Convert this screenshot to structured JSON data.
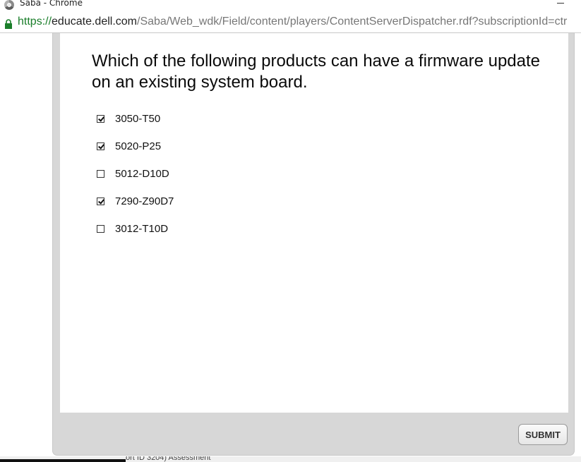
{
  "window": {
    "title": "Saba - Chrome"
  },
  "address_bar": {
    "scheme": "https://",
    "host": "educate.dell.com",
    "path": "/Saba/Web_wdk/Field/content/players/ContentServerDispatcher.rdf?subscriptionId=ctr"
  },
  "question": {
    "text": "Which of the following products can have a firmware update on an existing system board."
  },
  "options": [
    {
      "label": "3050-T50",
      "checked": true
    },
    {
      "label": "5020-P25",
      "checked": true
    },
    {
      "label": "5012-D10D",
      "checked": false
    },
    {
      "label": "7290-Z90D7",
      "checked": true
    },
    {
      "label": "3012-T10D",
      "checked": false
    }
  ],
  "submit_label": "SUBMIT",
  "taskbar": {
    "partial_text": "ort ID 3204) Assessment"
  }
}
